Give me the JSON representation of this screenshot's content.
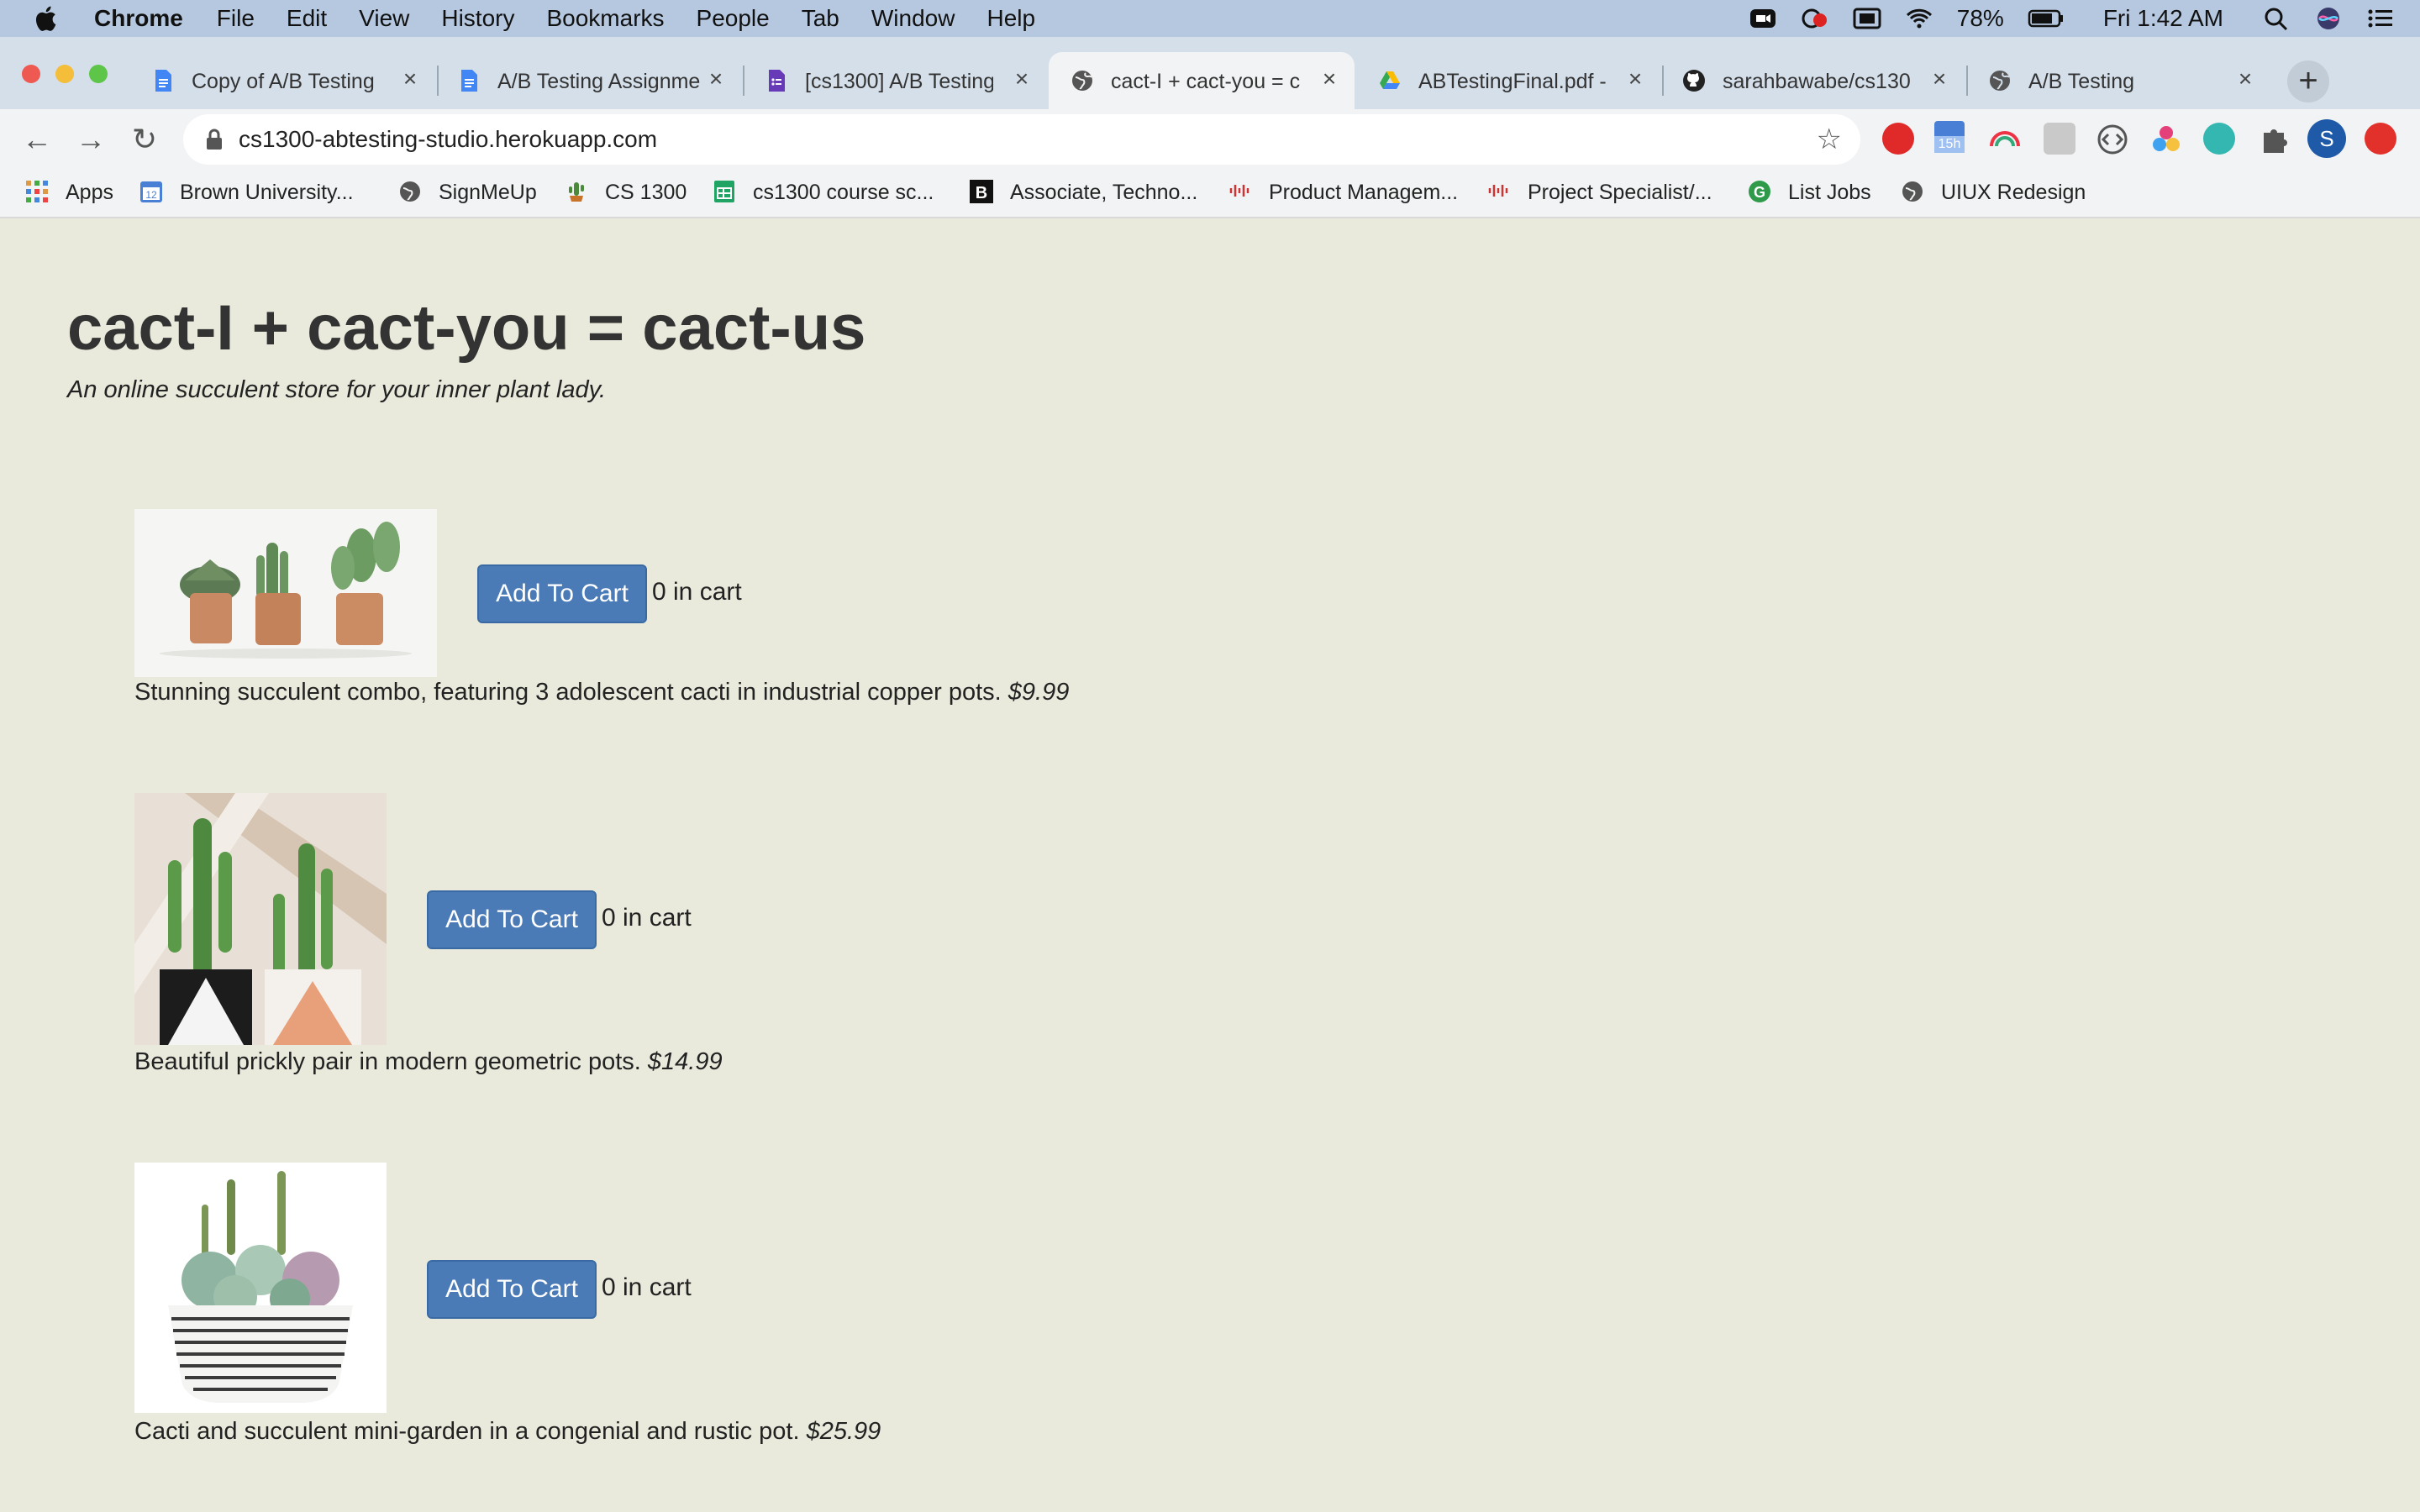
{
  "menubar": {
    "app_name": "Chrome",
    "items": [
      "File",
      "Edit",
      "View",
      "History",
      "Bookmarks",
      "People",
      "Tab",
      "Window",
      "Help"
    ],
    "battery": "78%",
    "clock": "Fri 1:42 AM"
  },
  "tabs": [
    {
      "title": "Copy of A/B Testing",
      "icon": "google-docs-icon",
      "active": false
    },
    {
      "title": "A/B Testing Assignme",
      "icon": "google-docs-icon",
      "active": false
    },
    {
      "title": "[cs1300] A/B Testing",
      "icon": "google-forms-icon",
      "active": false
    },
    {
      "title": "cact-I + cact-you = c",
      "icon": "globe-icon",
      "active": true
    },
    {
      "title": "ABTestingFinal.pdf -",
      "icon": "google-drive-icon",
      "active": false
    },
    {
      "title": "sarahbawabe/cs1300",
      "icon": "github-icon",
      "active": false
    },
    {
      "title": "A/B Testing",
      "icon": "globe-icon",
      "active": false
    }
  ],
  "toolbar": {
    "url": "cs1300-abtesting-studio.herokuapp.com",
    "calendar_badge": "15h"
  },
  "bookmarks": [
    {
      "label": "Apps",
      "icon": "apps-grid-icon"
    },
    {
      "label": "Brown University...",
      "icon": "calendar-icon"
    },
    {
      "label": "SignMeUp",
      "icon": "globe-icon"
    },
    {
      "label": "CS 1300",
      "icon": "cactus-icon"
    },
    {
      "label": "cs1300 course sc...",
      "icon": "sheets-icon"
    },
    {
      "label": "Associate, Techno...",
      "icon": "b-logo-icon"
    },
    {
      "label": "Product Managem...",
      "icon": "cisco-icon"
    },
    {
      "label": "Project Specialist/...",
      "icon": "cisco-icon"
    },
    {
      "label": "List Jobs",
      "icon": "g-logo-icon"
    },
    {
      "label": "UIUX Redesign",
      "icon": "globe-icon"
    }
  ],
  "page": {
    "title": "cact-I + cact-you = cact-us",
    "tagline": "An online succulent store for your inner plant lady.",
    "products": [
      {
        "description": "Stunning succulent combo, featuring 3 adolescent cacti in industrial copper pots.",
        "price": "$9.99",
        "button": "Add To Cart",
        "cart_count": "0 in cart"
      },
      {
        "description": "Beautiful prickly pair in modern geometric pots.",
        "price": "$14.99",
        "button": "Add To Cart",
        "cart_count": "0 in cart"
      },
      {
        "description": "Cacti and succulent mini-garden in a congenial and rustic pot.",
        "price": "$25.99",
        "button": "Add To Cart",
        "cart_count": "0 in cart"
      }
    ]
  }
}
